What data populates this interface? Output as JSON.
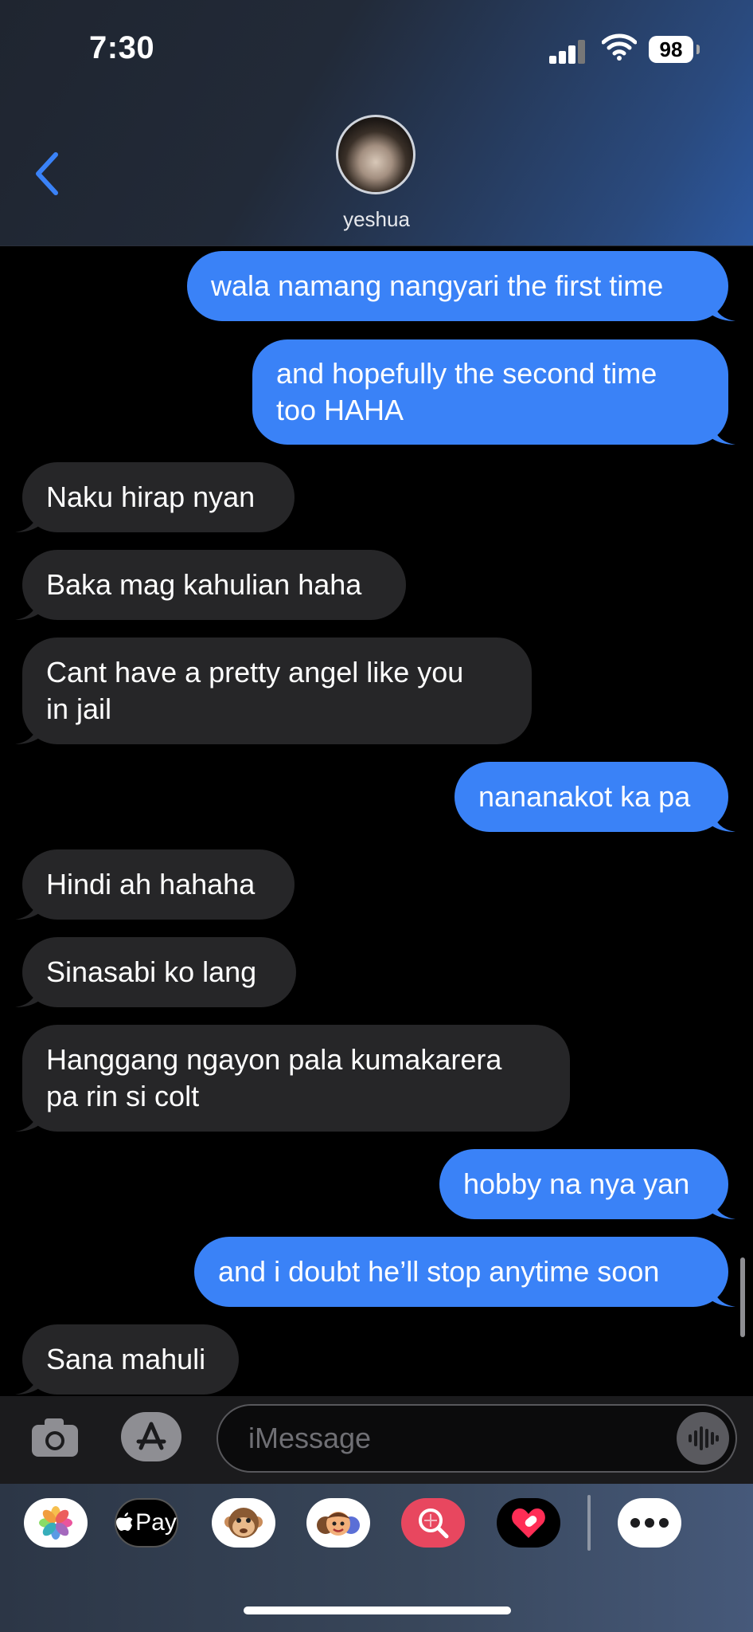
{
  "status_bar": {
    "time": "7:30",
    "battery": "98"
  },
  "header": {
    "contact_name": "yeshua"
  },
  "messages": [
    {
      "from": "me",
      "text": "wala namang nangyari the first time"
    },
    {
      "from": "me",
      "text_lines": [
        "and hopefully the second time",
        "too HAHA"
      ]
    },
    {
      "from": "them",
      "text": "Naku hirap nyan"
    },
    {
      "from": "them",
      "text": "Baka mag kahulian haha"
    },
    {
      "from": "them",
      "text_lines": [
        "Cant have a pretty angel like you",
        "in jail"
      ]
    },
    {
      "from": "me",
      "text": "nananakot ka pa"
    },
    {
      "from": "them",
      "text": "Hindi ah hahaha"
    },
    {
      "from": "them",
      "text": "Sinasabi ko lang"
    },
    {
      "from": "them",
      "text_lines": [
        "Hanggang ngayon pala kumakarera",
        "pa rin si colt"
      ]
    },
    {
      "from": "me",
      "text": "hobby na nya yan"
    },
    {
      "from": "me",
      "text": "and i doubt he’ll stop anytime soon"
    },
    {
      "from": "them",
      "text": "Sana mahuli"
    }
  ],
  "composer": {
    "placeholder": "iMessage"
  },
  "app_drawer": [
    {
      "name": "photos-icon"
    },
    {
      "name": "apple-pay-icon",
      "label": "Pay"
    },
    {
      "name": "animoji-icon"
    },
    {
      "name": "memoji-icon"
    },
    {
      "name": "image-search-icon"
    },
    {
      "name": "digital-touch-icon"
    },
    {
      "name": "more-apps-icon"
    }
  ],
  "colors": {
    "outgoing_bubble": "#3a82f7",
    "incoming_bubble": "#262628",
    "accent": "#3a82f7"
  }
}
